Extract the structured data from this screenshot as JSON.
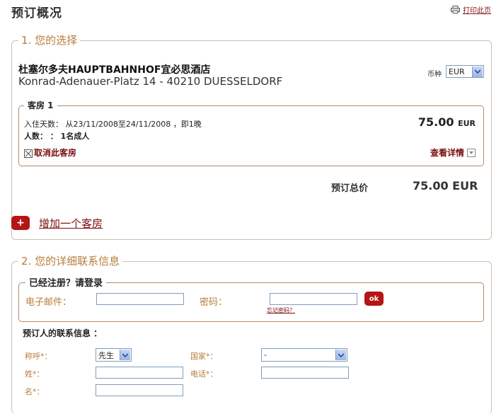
{
  "header": {
    "title": "预订概况",
    "print_label": "打印此页"
  },
  "section1": {
    "legend": "1. 您的选择",
    "hotel_name": "杜塞尔多夫HAUPTBAHNHOF宜必思酒店",
    "hotel_address": "Konrad-Adenauer-Platz 14 - 40210 DUESSELDORF",
    "currency_label": "币种",
    "currency_value": "EUR",
    "room": {
      "legend": "客房  1",
      "dates": "入住天数： 从23/11/2008至24/11/2008 ，即1晚",
      "persons": "人数： ： 1名成人",
      "price": "75.00",
      "currency": "EUR",
      "cancel_label": "取消此客房",
      "details_label": "查看详情"
    },
    "total_label": "预订总价",
    "total_value": "75.00 EUR",
    "add_room_label": "增加一个客房",
    "add_icon_glyph": "+"
  },
  "section2": {
    "legend": "2. 您的详细联系信息",
    "login": {
      "legend": "已经注册？请登录",
      "email_label": "电子邮件：",
      "email_value": "",
      "password_label": "密码：",
      "password_value": "",
      "ok_label": "ok",
      "forgot_label": "忘记密码？"
    },
    "contact_title": "预订人的联系信息 ：",
    "form": {
      "salutation_label": "称呼*：",
      "salutation_value": "先生",
      "country_label": "国家*：",
      "country_value": "-",
      "lastname_label": "姓*：",
      "lastname_value": "",
      "phone_label": "电话*：",
      "phone_value": "",
      "firstname_label": "名*：",
      "firstname_value": ""
    }
  },
  "colors": {
    "accent_red": "#b51515",
    "legend_brown": "#b77d3c",
    "link_red": "#7a0e0e"
  },
  "icons": [
    "printer-icon",
    "chevron-down-icon",
    "checkbox-icon",
    "plus-icon"
  ]
}
